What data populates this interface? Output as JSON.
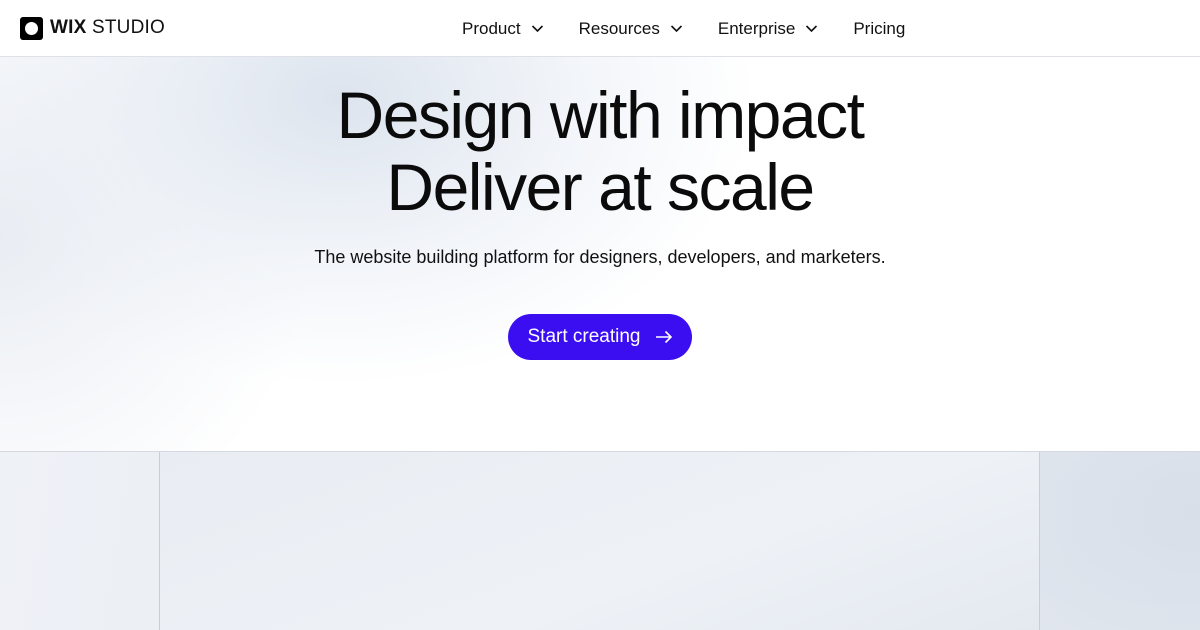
{
  "brand": {
    "name_bold": "WIX",
    "name_rest": "STUDIO",
    "logo_icon": "circle-in-square-icon"
  },
  "nav": {
    "items": [
      {
        "label": "Product",
        "has_dropdown": true
      },
      {
        "label": "Resources",
        "has_dropdown": true
      },
      {
        "label": "Enterprise",
        "has_dropdown": true
      },
      {
        "label": "Pricing",
        "has_dropdown": false
      }
    ]
  },
  "hero": {
    "headline_line1": "Design with impact",
    "headline_line2": "Deliver at scale",
    "subheadline": "The website building platform for designers, developers, and marketers.",
    "cta_label": "Start creating",
    "cta_icon": "arrow-right-icon",
    "cta_color": "#3b0ef2"
  }
}
